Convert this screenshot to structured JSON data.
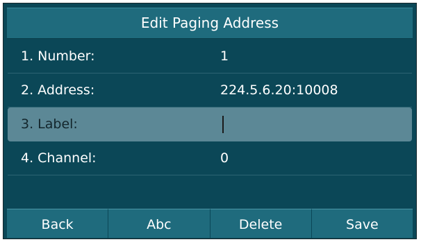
{
  "title": "Edit Paging Address",
  "fields": [
    {
      "label": "1. Number:",
      "value": "1"
    },
    {
      "label": "2. Address:",
      "value": "224.5.6.20:10008"
    },
    {
      "label": "3. Label:",
      "value": ""
    },
    {
      "label": "4. Channel:",
      "value": "0"
    }
  ],
  "softkeys": [
    "Back",
    "Abc",
    "Delete",
    "Save"
  ],
  "colors": {
    "background": "#0b4757",
    "bar": "#1f6b7d",
    "selected_row": "#5c8896",
    "text": "#ffffff"
  }
}
